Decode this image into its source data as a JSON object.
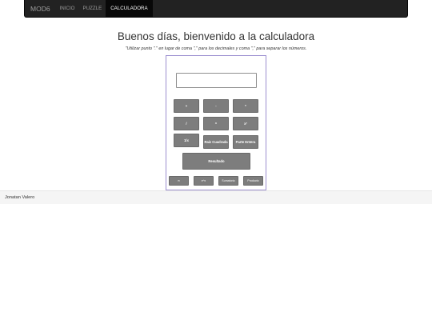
{
  "navbar": {
    "brand": "MOD6",
    "links": [
      "INICIO",
      "PUZZLE",
      "CALCULADORA"
    ]
  },
  "header": {
    "title": "Buenos días, bienvenido a la calculadora",
    "subtitle": "\"Utilizar punto \".\" en lugar de coma \",\" para los decimales y coma \",\" para separar los números."
  },
  "calculator": {
    "display_value": "",
    "buttons": {
      "add": "+",
      "subtract": "-",
      "multiply": "*",
      "divide": "/",
      "power": "^",
      "square": "x²",
      "reciprocal": "1/x",
      "sqrt": "Raíz Cuadrada",
      "integer_part": "Parte Entera",
      "result": "Resultado",
      "pi": "π",
      "e": "e^x",
      "sum": "Sumatorio",
      "product": "Producto"
    }
  },
  "footer": {
    "author": "Jonatan Valero"
  },
  "colors": {
    "navbar_bg": "#222222",
    "button_bg": "#7d7d7d",
    "calc_border": "#9c8fd0"
  }
}
